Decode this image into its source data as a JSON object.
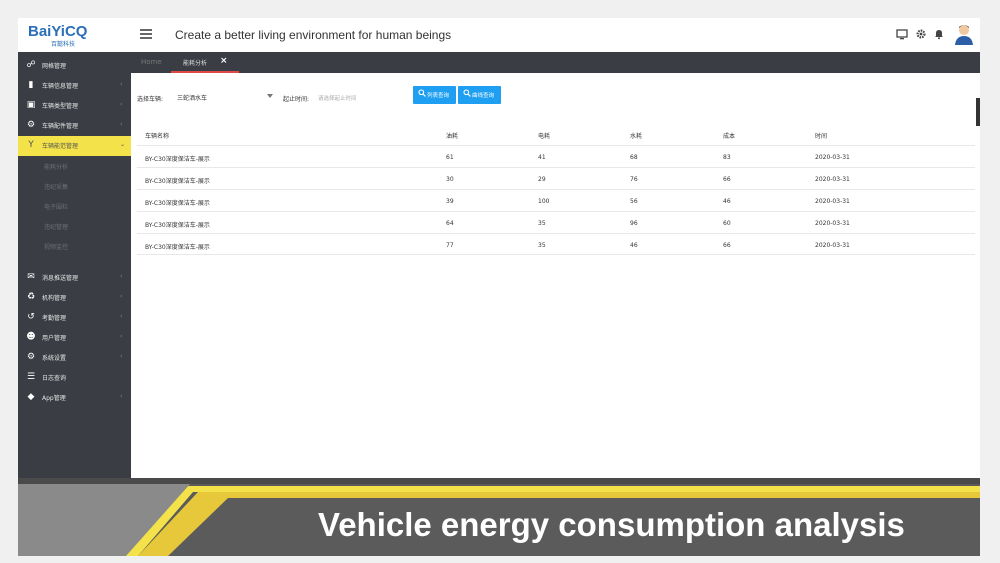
{
  "header": {
    "logo_brand": "BaiYiCQ",
    "logo_sub": "百懿科技",
    "slogan": "Create a better living environment for human beings"
  },
  "sidebar": {
    "items": [
      {
        "label": "网格管理",
        "icon": "globe-icon"
      },
      {
        "label": "车辆信息管理",
        "icon": "truck-icon"
      },
      {
        "label": "车辆类型管理",
        "icon": "cube-icon"
      },
      {
        "label": "车辆配件管理",
        "icon": "gear-icon"
      },
      {
        "label": "车辆能范管理",
        "icon": "filter-icon"
      },
      {
        "label": "消息推送管理",
        "icon": "mail-icon"
      },
      {
        "label": "机构管理",
        "icon": "bank-icon"
      },
      {
        "label": "考勤管理",
        "icon": "history-icon"
      },
      {
        "label": "用户管理",
        "icon": "users-icon"
      },
      {
        "label": "系统设置",
        "icon": "cogs-icon"
      },
      {
        "label": "日志查询",
        "icon": "list-icon"
      },
      {
        "label": "App管理",
        "icon": "diamond-icon"
      }
    ],
    "sub_items": [
      "能耗分析",
      "违纪采集",
      "电子围栏",
      "违纪管理",
      "视频监控"
    ]
  },
  "tabs": {
    "home": "Home",
    "active": "能耗分析"
  },
  "filters": {
    "vehicle_label": "选择车辆:",
    "vehicle_value": "三蛇洒水车",
    "date_label": "起止时间:",
    "date_placeholder": "请选择起止时间",
    "list_button": "列表查询",
    "curve_button": "曲线查询"
  },
  "table": {
    "headers": [
      "车辆名称",
      "油耗",
      "电耗",
      "水耗",
      "成本",
      "时间"
    ],
    "rows": [
      [
        "BY-C30深度保洁车-展示",
        "61",
        "41",
        "68",
        "83",
        "2020-03-31"
      ],
      [
        "BY-C30深度保洁车-展示",
        "30",
        "29",
        "76",
        "66",
        "2020-03-31"
      ],
      [
        "BY-C30深度保洁车-展示",
        "39",
        "100",
        "56",
        "46",
        "2020-03-31"
      ],
      [
        "BY-C30深度保洁车-展示",
        "64",
        "35",
        "96",
        "60",
        "2020-03-31"
      ],
      [
        "BY-C30深度保洁车-展示",
        "77",
        "35",
        "46",
        "66",
        "2020-03-31"
      ]
    ]
  },
  "banner": {
    "title": "Vehicle energy consumption analysis",
    "accent_color": "#f3e24a"
  }
}
